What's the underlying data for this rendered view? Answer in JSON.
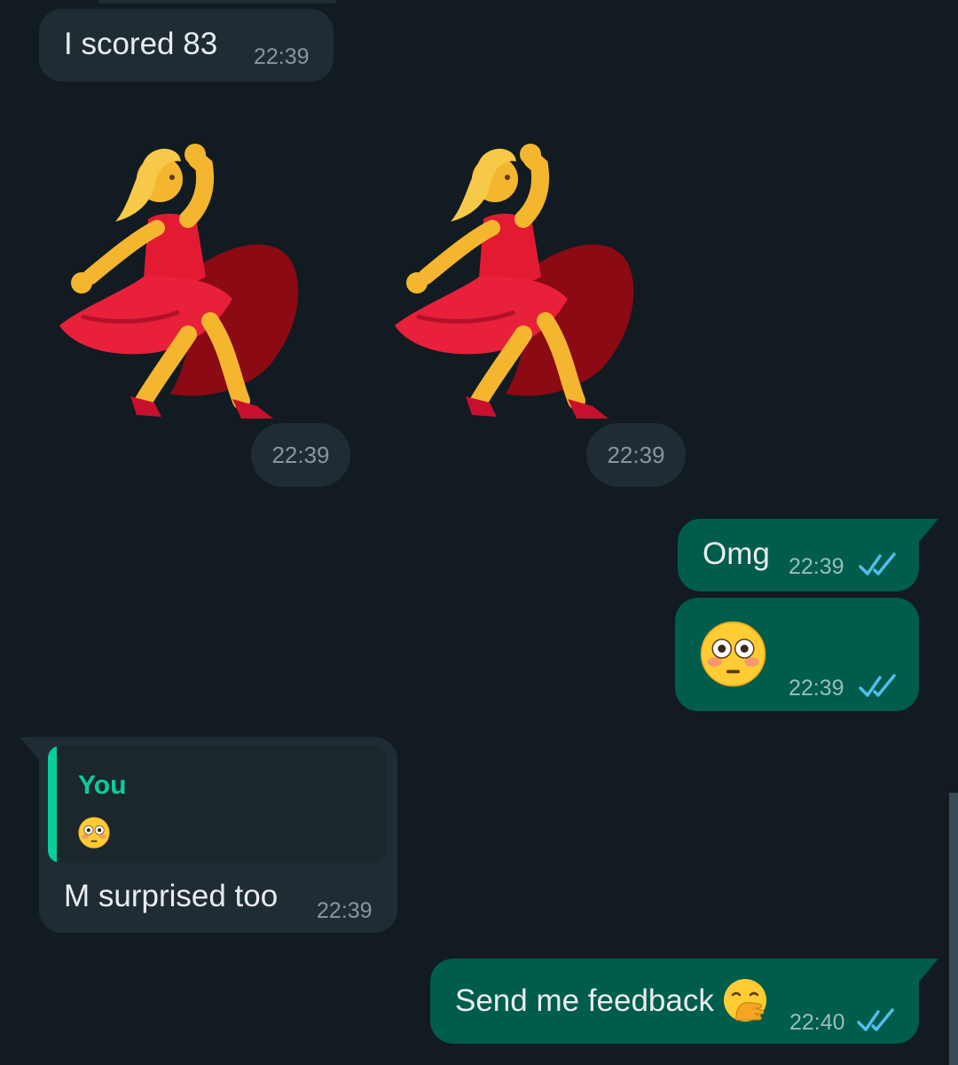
{
  "messages": {
    "m1": {
      "text": "I scored 83",
      "time": "22:39"
    },
    "sticker1": {
      "time": "22:39",
      "icon": "woman-dancing-sticker"
    },
    "sticker2": {
      "time": "22:39",
      "icon": "woman-dancing-sticker"
    },
    "m2": {
      "text": "Omg",
      "time": "22:39",
      "status": "read"
    },
    "m3": {
      "emoji": "flushed-face",
      "time": "22:39",
      "status": "read"
    },
    "m4": {
      "quote": {
        "author": "You",
        "emoji": "flushed-face"
      },
      "text": "M surprised too",
      "time": "22:39"
    },
    "m5": {
      "text": "Send me feedback",
      "emoji": "face-with-hand-over-mouth",
      "time": "22:40",
      "status": "read"
    }
  },
  "colors": {
    "background": "#111B21",
    "incoming_bubble": "#202C33",
    "outgoing_bubble": "#005C4B",
    "read_ticks": "#53BDEB",
    "quote_accent": "#06CF9C"
  }
}
